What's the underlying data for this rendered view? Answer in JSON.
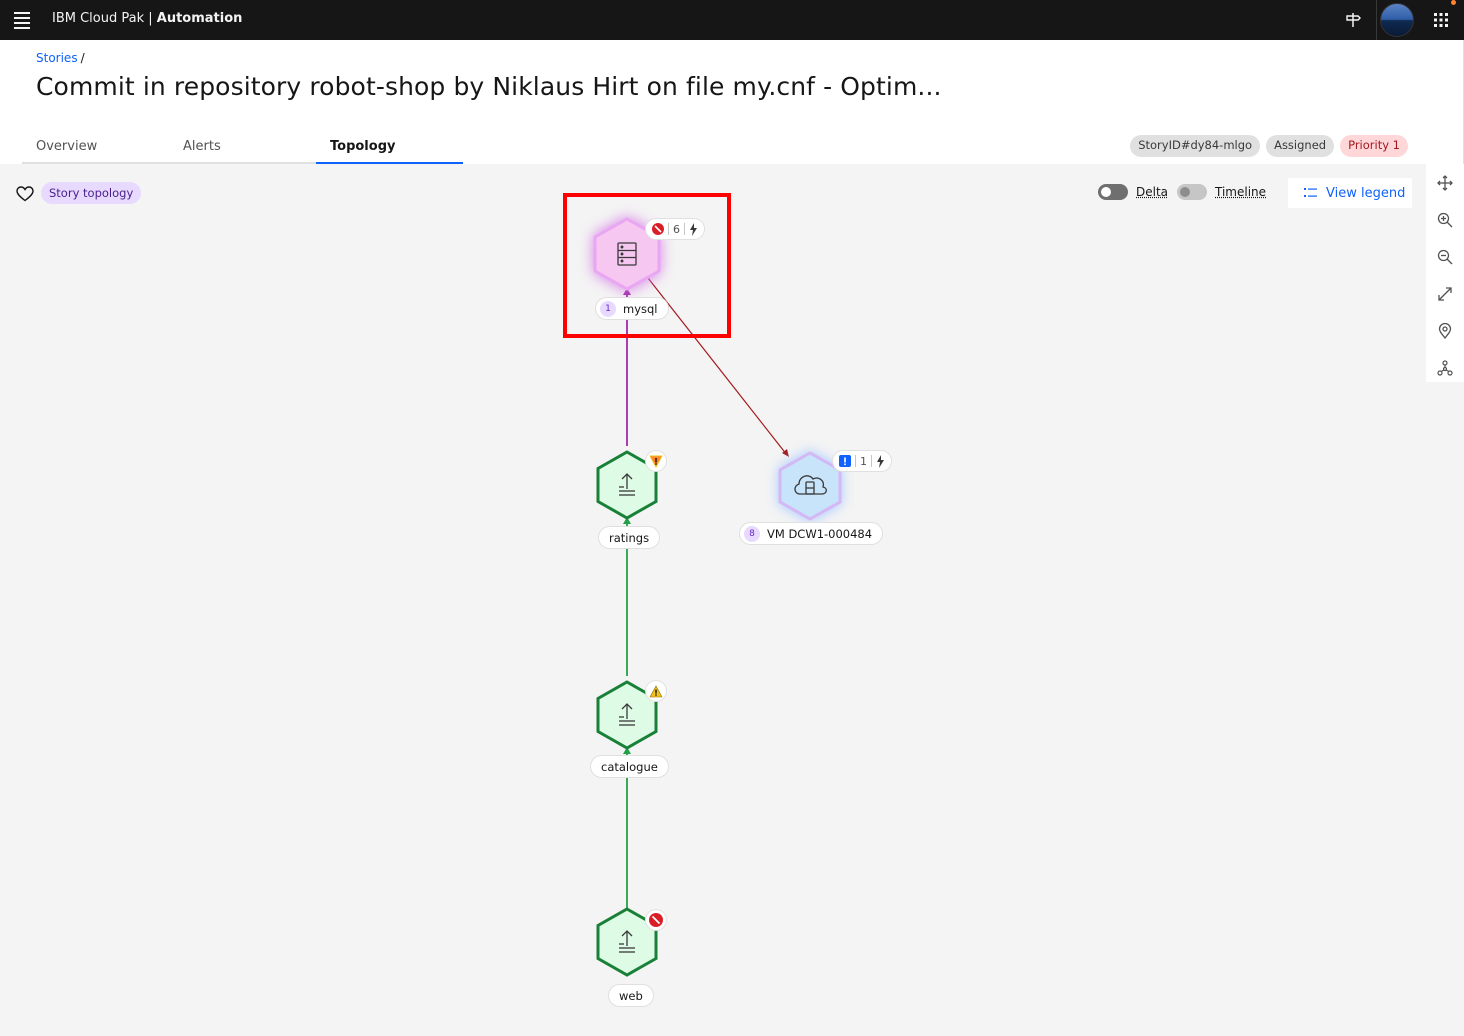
{
  "app": {
    "brand_prefix": "IBM Cloud Pak",
    "brand_divider": " | ",
    "brand_product": "Automation"
  },
  "breadcrumb": {
    "link": "Stories",
    "separator": "/"
  },
  "page": {
    "title": "Commit in repository robot-shop by Niklaus Hirt on file my.cnf - Optim..."
  },
  "tabs": [
    {
      "label": "Overview",
      "active": false
    },
    {
      "label": "Alerts",
      "active": false
    },
    {
      "label": "Topology",
      "active": true
    }
  ],
  "tags": {
    "story_id": "StoryID#dy84-mlgo",
    "status": "Assigned",
    "priority": "Priority 1"
  },
  "canvas": {
    "story_tag": "Story topology",
    "delta_label": "Delta",
    "timeline_label": "Timeline",
    "legend_button": "View legend"
  },
  "nodes": {
    "mysql": {
      "label": "mysql",
      "count": "1",
      "alert_count": "6",
      "icon": "server-icon",
      "severity": "critical"
    },
    "vm": {
      "label": "VM DCW1-000484",
      "count": "8",
      "alert_count": "1",
      "icon": "cloud-database-icon",
      "severity": "info"
    },
    "ratings": {
      "label": "ratings",
      "icon": "deploy-icon",
      "severity": "minor"
    },
    "catalogue": {
      "label": "catalogue",
      "icon": "deploy-icon",
      "severity": "warning"
    },
    "web": {
      "label": "web",
      "icon": "deploy-icon",
      "severity": "critical"
    }
  },
  "colors": {
    "accent": "#0f62fe",
    "critical": "#da1e28",
    "warning": "#f1c21b",
    "healthy_node": "#24a148",
    "mysql_fill": "#f6c7f0",
    "vm_fill": "#c8e4fb"
  }
}
